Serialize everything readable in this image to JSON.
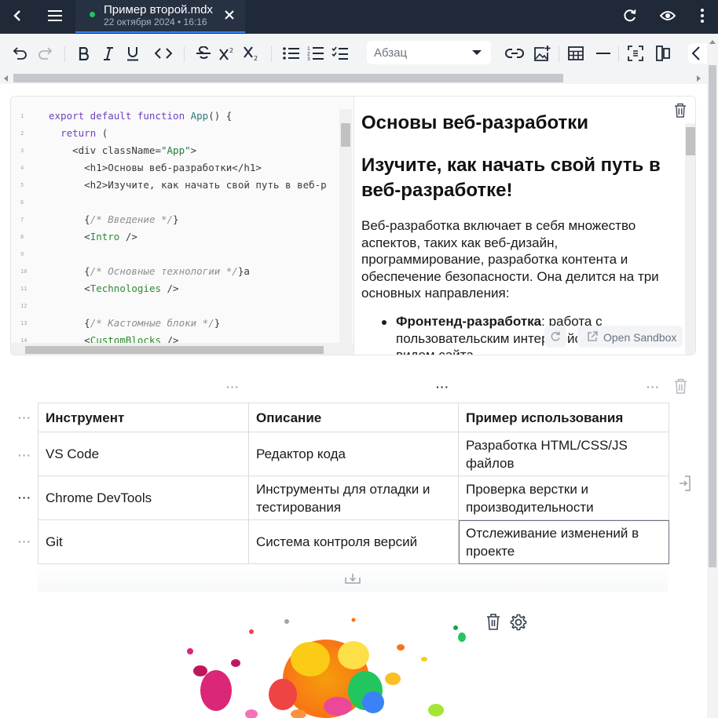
{
  "topbar": {
    "tab_title": "Пример второй.mdx",
    "tab_subtitle": "22 октября 2024 • 16:16"
  },
  "toolbar": {
    "block_type": "Абзац"
  },
  "code_lines": [
    {
      "n": "1",
      "html": "<span class='kw'>export default function</span> <span class='fn'>App</span>() {"
    },
    {
      "n": "2",
      "html": "  <span class='kw'>return</span> ("
    },
    {
      "n": "3",
      "html": "    &lt;div className=<span class='str'>\"App\"</span>&gt;"
    },
    {
      "n": "4",
      "html": "      &lt;h1&gt;Основы веб-разработки&lt;/h1&gt;"
    },
    {
      "n": "5",
      "html": "      &lt;h2&gt;Изучите, как начать свой путь в веб-р"
    },
    {
      "n": "6",
      "html": ""
    },
    {
      "n": "7",
      "html": "      {<span class='cm'>/* Введение */</span>}"
    },
    {
      "n": "8",
      "html": "      &lt;<span class='tag'>Intro</span> /&gt;"
    },
    {
      "n": "9",
      "html": ""
    },
    {
      "n": "10",
      "html": "      {<span class='cm'>/* Основные технологии */</span>}a"
    },
    {
      "n": "11",
      "html": "      &lt;<span class='tag'>Technologies</span> /&gt;"
    },
    {
      "n": "12",
      "html": ""
    },
    {
      "n": "13",
      "html": "      {<span class='cm'>/* Кастомные блоки */</span>}"
    },
    {
      "n": "14",
      "html": "      &lt;<span class='tag'>CustomBlocks</span> /&gt;"
    }
  ],
  "preview": {
    "h1": "Основы веб-разработки",
    "h2": "Изучите, как начать свой путь в веб-разработке!",
    "paragraph": "Веб-разработка включает в себя множество аспектов, таких как веб-дизайн, программирование, разработка контента и обеспечение безопасности. Она делится на три основных направления:",
    "li_bold": "Фронтенд-разработка",
    "li_rest": ": работа с пользовательским интерфейсом и внешним видом сайта.",
    "open_sandbox": "Open Sandbox"
  },
  "table": {
    "headers": [
      "Инструмент",
      "Описание",
      "Пример использования"
    ],
    "rows": [
      [
        "VS Code",
        "Редактор кода",
        "Разработка HTML/CSS/JS файлов"
      ],
      [
        "Chrome DevTools",
        "Инструменты для отладки и тестирования",
        "Проверка верстки и производительности"
      ],
      [
        "Git",
        "Система контроля версий",
        "Отслеживание изменений в проекте"
      ]
    ]
  },
  "colors": {
    "topbar_bg": "#1f2937",
    "accent": "#3b82f6",
    "status_dot": "#22c55e"
  }
}
